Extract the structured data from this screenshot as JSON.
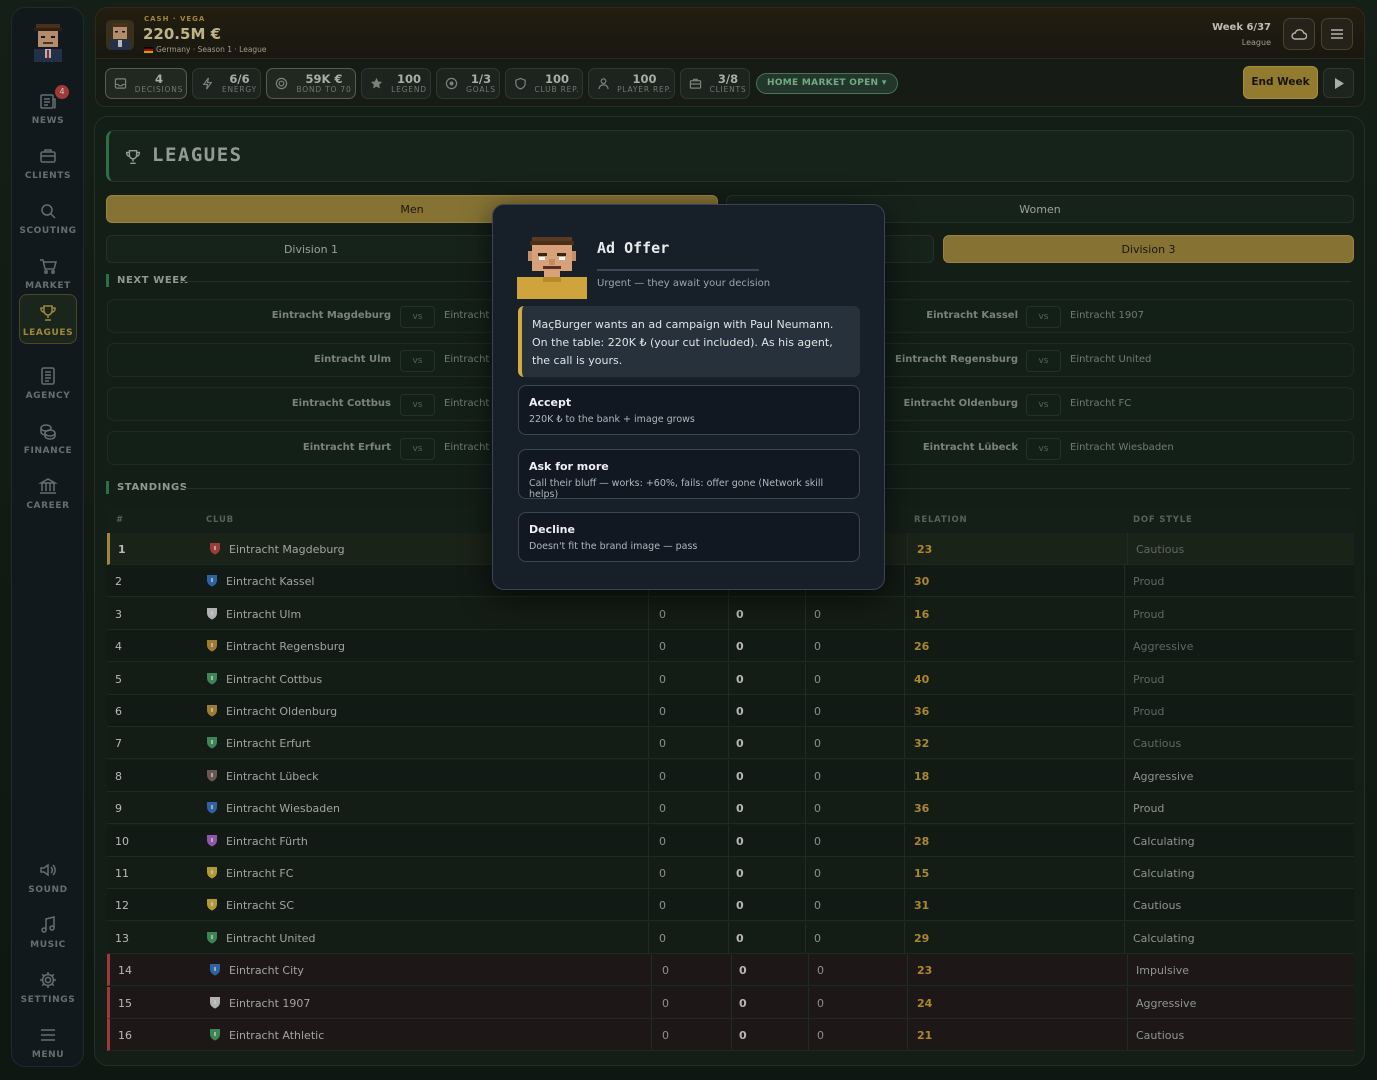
{
  "sidebar": {
    "news_badge": "4",
    "items": [
      {
        "label": "NEWS",
        "icon": "newspaper-icon"
      },
      {
        "label": "CLIENTS",
        "icon": "briefcase-icon"
      },
      {
        "label": "SCOUTING",
        "icon": "search-icon"
      },
      {
        "label": "MARKET",
        "icon": "cart-icon"
      },
      {
        "label": "LEAGUES",
        "icon": "trophy-icon"
      },
      {
        "label": "AGENCY",
        "icon": "document-icon"
      },
      {
        "label": "FINANCE",
        "icon": "coins-icon"
      },
      {
        "label": "CAREER",
        "icon": "bank-icon"
      }
    ],
    "bottom": [
      {
        "label": "SOUND",
        "icon": "speaker-icon"
      },
      {
        "label": "MUSIC",
        "icon": "music-note-icon"
      },
      {
        "label": "SETTINGS",
        "icon": "gear-icon"
      },
      {
        "label": "MENU",
        "icon": "menu-icon"
      }
    ]
  },
  "topbar": {
    "cash_label": "CASH · VEGA",
    "cash": "220.5M €",
    "subtitle": "Germany · Season 1 · League",
    "week": "Week 6/37",
    "league": "League"
  },
  "stats": [
    {
      "value": "4",
      "label": "DECISIONS"
    },
    {
      "value": "6/6",
      "label": "ENERGY"
    },
    {
      "value": "59K €",
      "label": "BOND TO 70"
    },
    {
      "value": "100",
      "label": "LEGEND"
    },
    {
      "value": "1/3",
      "label": "GOALS"
    },
    {
      "value": "100",
      "label": "CLUB REP."
    },
    {
      "value": "100",
      "label": "PLAYER REP."
    },
    {
      "value": "3/8",
      "label": "CLIENTS"
    }
  ],
  "market_status": "HOME MARKET OPEN ▾",
  "end_week": "End Week",
  "page": {
    "title": "LEAGUES",
    "gender_tabs": [
      "Men",
      "Women"
    ],
    "division_tabs": [
      "Division 1",
      "Division 3"
    ],
    "next_week_label": "NEXT WEEK",
    "standings_label": "STANDINGS",
    "vs": "vs"
  },
  "fixtures": [
    {
      "home": "Eintracht Magdeburg",
      "away": "Eintracht A"
    },
    {
      "home": "Eintracht Ulm",
      "away": "Eintracht C"
    },
    {
      "home": "Eintracht Cottbus",
      "away": "Eintracht S"
    },
    {
      "home": "Eintracht Erfurt",
      "away": "Eintracht F"
    },
    {
      "home": "Eintracht Kassel",
      "away": "Eintracht 1907"
    },
    {
      "home": "Eintracht Regensburg",
      "away": "Eintracht United"
    },
    {
      "home": "Eintracht Oldenburg",
      "away": "Eintracht FC"
    },
    {
      "home": "Eintracht Lübeck",
      "away": "Eintracht Wiesbaden"
    }
  ],
  "standings": {
    "headers": {
      "pos": "#",
      "club": "CLUB",
      "relation": "RELATION",
      "dof_style": "DOF STYLE"
    },
    "rows": [
      {
        "pos": "1",
        "club": "Eintracht Magdeburg",
        "c1": "",
        "c2": "",
        "c3": "",
        "relation": "23",
        "style": "Cautious",
        "color": "#c44a4a"
      },
      {
        "pos": "2",
        "club": "Eintracht Kassel",
        "c1": "",
        "c2": "",
        "c3": "",
        "relation": "30",
        "style": "Proud",
        "color": "#3a7ad0"
      },
      {
        "pos": "3",
        "club": "Eintracht Ulm",
        "c1": "0",
        "c2": "0",
        "c3": "0",
        "relation": "16",
        "style": "Proud",
        "color": "#e0e0e0"
      },
      {
        "pos": "4",
        "club": "Eintracht Regensburg",
        "c1": "0",
        "c2": "0",
        "c3": "0",
        "relation": "26",
        "style": "Aggressive",
        "color": "#c99a3a"
      },
      {
        "pos": "5",
        "club": "Eintracht Cottbus",
        "c1": "0",
        "c2": "0",
        "c3": "0",
        "relation": "40",
        "style": "Proud",
        "color": "#4aa86a"
      },
      {
        "pos": "6",
        "club": "Eintracht Oldenburg",
        "c1": "0",
        "c2": "0",
        "c3": "0",
        "relation": "36",
        "style": "Proud",
        "color": "#c99a3a"
      },
      {
        "pos": "7",
        "club": "Eintracht Erfurt",
        "c1": "0",
        "c2": "0",
        "c3": "0",
        "relation": "32",
        "style": "Cautious",
        "color": "#4aa86a"
      },
      {
        "pos": "8",
        "club": "Eintracht Lübeck",
        "c1": "0",
        "c2": "0",
        "c3": "0",
        "relation": "18",
        "style": "Aggressive",
        "color": "#8a6a6a"
      },
      {
        "pos": "9",
        "club": "Eintracht Wiesbaden",
        "c1": "0",
        "c2": "0",
        "c3": "0",
        "relation": "36",
        "style": "Proud",
        "color": "#3a7ad0"
      },
      {
        "pos": "10",
        "club": "Eintracht Fürth",
        "c1": "0",
        "c2": "0",
        "c3": "0",
        "relation": "28",
        "style": "Calculating",
        "color": "#b86ad8"
      },
      {
        "pos": "11",
        "club": "Eintracht FC",
        "c1": "0",
        "c2": "0",
        "c3": "0",
        "relation": "15",
        "style": "Calculating",
        "color": "#e0c040"
      },
      {
        "pos": "12",
        "club": "Eintracht SC",
        "c1": "0",
        "c2": "0",
        "c3": "0",
        "relation": "31",
        "style": "Cautious",
        "color": "#e0c040"
      },
      {
        "pos": "13",
        "club": "Eintracht United",
        "c1": "0",
        "c2": "0",
        "c3": "0",
        "relation": "29",
        "style": "Calculating",
        "color": "#4aa86a"
      },
      {
        "pos": "14",
        "club": "Eintracht City",
        "c1": "0",
        "c2": "0",
        "c3": "0",
        "relation": "23",
        "style": "Impulsive",
        "color": "#3a7ad0"
      },
      {
        "pos": "15",
        "club": "Eintracht 1907",
        "c1": "0",
        "c2": "0",
        "c3": "0",
        "relation": "24",
        "style": "Aggressive",
        "color": "#e0e0e0"
      },
      {
        "pos": "16",
        "club": "Eintracht Athletic",
        "c1": "0",
        "c2": "0",
        "c3": "0",
        "relation": "21",
        "style": "Cautious",
        "color": "#4aa86a"
      }
    ]
  },
  "modal": {
    "title": "Ad Offer",
    "subtitle": "Urgent — they await your decision",
    "message": "MaçBurger wants an ad campaign with Paul Neumann. On the table: 220K ₺ (your cut included). As his agent, the call is yours.",
    "options": [
      {
        "title": "Accept",
        "desc": "220K ₺ to the bank + image grows"
      },
      {
        "title": "Ask for more",
        "desc": "Call their bluff — works: +60%, fails: offer gone (Network skill helps)"
      },
      {
        "title": "Decline",
        "desc": "Doesn't fit the brand image — pass"
      }
    ]
  },
  "colors": {
    "accent_gold": "#b99a3a",
    "relegation": "#c84848",
    "promotion": "#c9a84b",
    "relation": "#d9a83a"
  }
}
